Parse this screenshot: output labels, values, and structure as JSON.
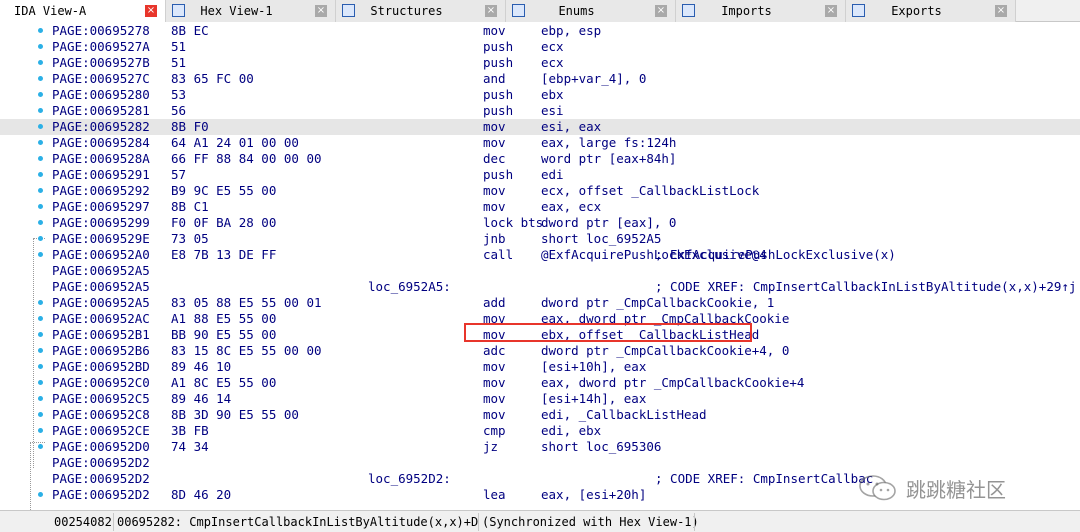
{
  "tabs": [
    {
      "label": "IDA View-A",
      "active": true,
      "icon": "ida-view-icon"
    },
    {
      "label": "Hex View-1",
      "active": false,
      "icon": "hex-view-icon"
    },
    {
      "label": "Structures",
      "active": false,
      "icon": "structures-icon"
    },
    {
      "label": "Enums",
      "active": false,
      "icon": "enums-icon"
    },
    {
      "label": "Imports",
      "active": false,
      "icon": "imports-icon"
    },
    {
      "label": "Exports",
      "active": false,
      "icon": "exports-icon"
    }
  ],
  "close_glyph": "×",
  "rows": [
    {
      "addr": "PAGE:00695278",
      "bytes": "8B EC",
      "label": "",
      "mnem": "mov",
      "ops": "ebp, esp",
      "comment": ""
    },
    {
      "addr": "PAGE:0069527A",
      "bytes": "51",
      "label": "",
      "mnem": "push",
      "ops": "ecx",
      "comment": ""
    },
    {
      "addr": "PAGE:0069527B",
      "bytes": "51",
      "label": "",
      "mnem": "push",
      "ops": "ecx",
      "comment": ""
    },
    {
      "addr": "PAGE:0069527C",
      "bytes": "83 65 FC 00",
      "label": "",
      "mnem": "and",
      "ops": "[ebp+var_4], 0",
      "comment": ""
    },
    {
      "addr": "PAGE:00695280",
      "bytes": "53",
      "label": "",
      "mnem": "push",
      "ops": "ebx",
      "comment": ""
    },
    {
      "addr": "PAGE:00695281",
      "bytes": "56",
      "label": "",
      "mnem": "push",
      "ops": "esi",
      "comment": ""
    },
    {
      "addr": "PAGE:00695282",
      "bytes": "8B F0",
      "label": "",
      "mnem": "mov",
      "ops": "esi, eax",
      "comment": "",
      "highlight": true
    },
    {
      "addr": "PAGE:00695284",
      "bytes": "64 A1 24 01 00 00",
      "label": "",
      "mnem": "mov",
      "ops": "eax, large fs:124h",
      "comment": ""
    },
    {
      "addr": "PAGE:0069528A",
      "bytes": "66 FF 88 84 00 00 00",
      "label": "",
      "mnem": "dec",
      "ops": "word ptr [eax+84h]",
      "comment": ""
    },
    {
      "addr": "PAGE:00695291",
      "bytes": "57",
      "label": "",
      "mnem": "push",
      "ops": "edi",
      "comment": ""
    },
    {
      "addr": "PAGE:00695292",
      "bytes": "B9 9C E5 55 00",
      "label": "",
      "mnem": "mov",
      "ops": "ecx, offset _CallbackListLock",
      "comment": ""
    },
    {
      "addr": "PAGE:00695297",
      "bytes": "8B C1",
      "label": "",
      "mnem": "mov",
      "ops": "eax, ecx",
      "comment": ""
    },
    {
      "addr": "PAGE:00695299",
      "bytes": "F0 0F BA 28 00",
      "label": "",
      "mnem": "lock bts",
      "ops": "dword ptr [eax], 0",
      "comment": ""
    },
    {
      "addr": "PAGE:0069529E",
      "bytes": "73 05",
      "label": "",
      "mnem": "jnb",
      "ops": "short loc_6952A5",
      "comment": ""
    },
    {
      "addr": "PAGE:006952A0",
      "bytes": "E8 7B 13 DE FF",
      "label": "",
      "mnem": "call",
      "ops": "@ExfAcquirePushLockExclusive@4",
      "comment": "; ExfAcquirePushLockExclusive(x)"
    },
    {
      "addr": "PAGE:006952A5",
      "bytes": "",
      "label": "",
      "mnem": "",
      "ops": "",
      "comment": ""
    },
    {
      "addr": "PAGE:006952A5",
      "bytes": "",
      "label": "loc_6952A5:",
      "mnem": "",
      "ops": "",
      "comment": "; CODE XREF: CmpInsertCallbackInListByAltitude(x,x)+29↑j"
    },
    {
      "addr": "PAGE:006952A5",
      "bytes": "83 05 88 E5 55 00 01",
      "label": "",
      "mnem": "add",
      "ops": "dword ptr _CmpCallbackCookie, 1",
      "comment": ""
    },
    {
      "addr": "PAGE:006952AC",
      "bytes": "A1 88 E5 55 00",
      "label": "",
      "mnem": "mov",
      "ops": "eax, dword ptr _CmpCallbackCookie",
      "comment": ""
    },
    {
      "addr": "PAGE:006952B1",
      "bytes": "BB 90 E5 55 00",
      "label": "",
      "mnem": "mov",
      "ops": "ebx, offset _CallbackListHead",
      "comment": ""
    },
    {
      "addr": "PAGE:006952B6",
      "bytes": "83 15 8C E5 55 00 00",
      "label": "",
      "mnem": "adc",
      "ops": "dword ptr _CmpCallbackCookie+4, 0",
      "comment": ""
    },
    {
      "addr": "PAGE:006952BD",
      "bytes": "89 46 10",
      "label": "",
      "mnem": "mov",
      "ops": "[esi+10h], eax",
      "comment": ""
    },
    {
      "addr": "PAGE:006952C0",
      "bytes": "A1 8C E5 55 00",
      "label": "",
      "mnem": "mov",
      "ops": "eax, dword ptr _CmpCallbackCookie+4",
      "comment": ""
    },
    {
      "addr": "PAGE:006952C5",
      "bytes": "89 46 14",
      "label": "",
      "mnem": "mov",
      "ops": "[esi+14h], eax",
      "comment": ""
    },
    {
      "addr": "PAGE:006952C8",
      "bytes": "8B 3D 90 E5 55 00",
      "label": "",
      "mnem": "mov",
      "ops": "edi, _CallbackListHead",
      "comment": ""
    },
    {
      "addr": "PAGE:006952CE",
      "bytes": "3B FB",
      "label": "",
      "mnem": "cmp",
      "ops": "edi, ebx",
      "comment": ""
    },
    {
      "addr": "PAGE:006952D0",
      "bytes": "74 34",
      "label": "",
      "mnem": "jz",
      "ops": "short loc_695306",
      "comment": ""
    },
    {
      "addr": "PAGE:006952D2",
      "bytes": "",
      "label": "",
      "mnem": "",
      "ops": "",
      "comment": ""
    },
    {
      "addr": "PAGE:006952D2",
      "bytes": "",
      "label": "loc_6952D2:",
      "mnem": "",
      "ops": "",
      "comment": "; CODE XREF: CmpInsertCallbac"
    },
    {
      "addr": "PAGE:006952D2",
      "bytes": "8D 46 20",
      "label": "",
      "mnem": "lea",
      "ops": "eax, [esi+20h]",
      "comment": ""
    }
  ],
  "status": {
    "offset": "00254082",
    "location": "00695282: CmpInsertCallbackInListByAltitude(x,x)+D",
    "sync": "(Synchronized with Hex View-1)"
  },
  "watermark": "跳跳糖社区"
}
